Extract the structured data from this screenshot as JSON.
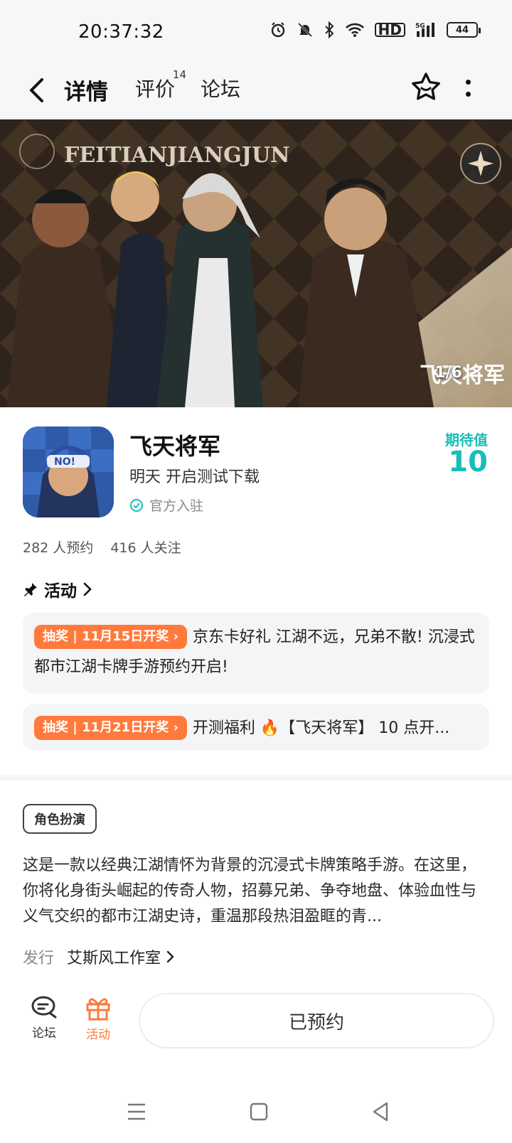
{
  "status_bar": {
    "time": "20:37:32",
    "battery": "44",
    "hd": "HD",
    "network": "5G"
  },
  "nav": {
    "tabs": [
      {
        "label": "详情",
        "active": true
      },
      {
        "label": "评价",
        "count": "14"
      },
      {
        "label": "论坛"
      }
    ]
  },
  "banner": {
    "counter": "1/6",
    "logo_text": "飞天将军",
    "title_text": "FEITIANJIANGJUN"
  },
  "game": {
    "title": "飞天将军",
    "subtitle": "明天 开启测试下载",
    "official": "官方入驻",
    "expect_label": "期待值",
    "expect_value": "10",
    "reservations": "282 人预约",
    "followers": "416 人关注"
  },
  "activity": {
    "heading": "活动",
    "items": [
      {
        "badge": "抽奖 | 11月15日开奖",
        "text": "京东卡好礼 江湖不远，兄弟不散! 沉浸式都市江湖卡牌手游预约开启!"
      },
      {
        "badge": "抽奖 | 11月21日开奖",
        "text": "开测福利 🔥【飞天将军】 10 点开..."
      }
    ]
  },
  "details": {
    "genre": "角色扮演",
    "description": "这是一款以经典江湖情怀为背景的沉浸式卡牌策略手游。在这里，你将化身街头崛起的传奇人物，招募兄弟、争夺地盘、体验血性与义气交织的都市江湖史诗，重温那段热泪盈眶的青...",
    "publisher_label": "发行",
    "publisher_name": "艾斯风工作室"
  },
  "bottom_bar": {
    "forum_label": "论坛",
    "activity_label": "活动",
    "reserved_label": "已预约"
  },
  "colors": {
    "accent": "#17bdb7",
    "orange": "#ff7a3c",
    "card_bg": "#f4f5f7"
  }
}
